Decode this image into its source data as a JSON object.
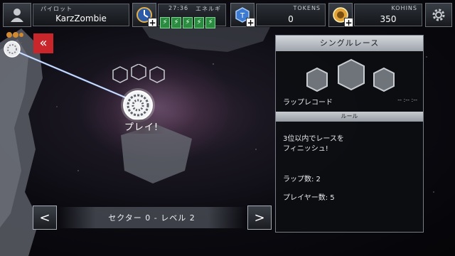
{
  "topbar": {
    "pilot_label": "パイロット",
    "pilot_name": "KarzZombie",
    "energy_timer": "27:36",
    "energy_label": "エネルギ",
    "energy_cells": [
      "⚡",
      "⚡",
      "⚡",
      "⚡",
      "⚡"
    ],
    "tokens_label": "TOKENS",
    "tokens_value": "0",
    "kohins_label": "KOHINS",
    "kohins_value": "350"
  },
  "map": {
    "back_label": "«",
    "play_label": "プレイ!"
  },
  "race_panel": {
    "title": "シングルレース",
    "lap_record_label": "ラップレコード",
    "lap_record_value": "-- :-- :--",
    "rules_label": "ルール",
    "rule_line1": "3位以内でレースを",
    "rule_line2": "フィニッシュ!",
    "laps_text": "ラップ数: 2",
    "players_text": "プレイヤー数: 5"
  },
  "navigation": {
    "prev_label": "<",
    "next_label": ">",
    "level_text": "セクター 0 - レベル 2"
  }
}
